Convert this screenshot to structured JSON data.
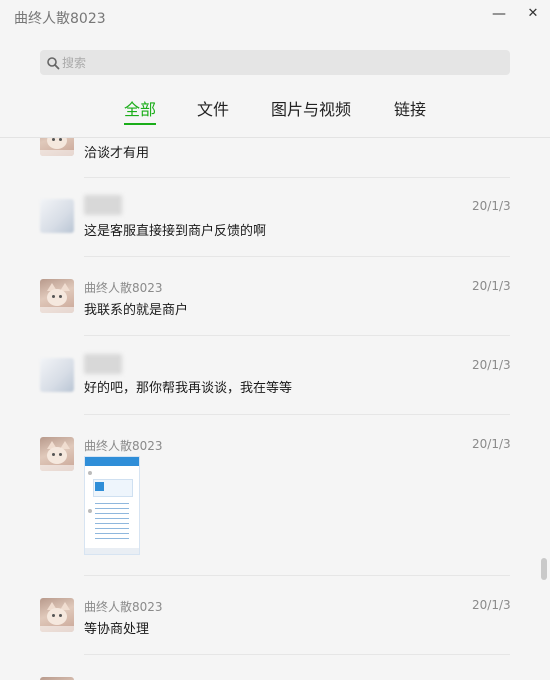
{
  "window": {
    "title": "曲终人散8023",
    "minimize_glyph": "—",
    "close_glyph": "✕"
  },
  "search": {
    "placeholder": "搜索",
    "value": ""
  },
  "tabs": [
    {
      "label": "全部",
      "active": true
    },
    {
      "label": "文件",
      "active": false
    },
    {
      "label": "图片与视频",
      "active": false
    },
    {
      "label": "链接",
      "active": false
    }
  ],
  "messages": [
    {
      "sender": "",
      "date": "",
      "text": "洽谈才有用",
      "avatar": "cat-avatar"
    },
    {
      "sender": "",
      "date": "20/1/3",
      "text": "这是客服直接接到商户反馈的啊",
      "avatar": "blurred-avatar"
    },
    {
      "sender": "曲终人散8023",
      "date": "20/1/3",
      "text": "我联系的就是商户",
      "avatar": "cat-avatar"
    },
    {
      "sender": "",
      "date": "20/1/3",
      "text": "好的吧，那你帮我再谈谈，我在等等",
      "avatar": "blurred-avatar"
    },
    {
      "sender": "曲终人散8023",
      "date": "20/1/3",
      "text": "",
      "avatar": "cat-avatar",
      "attachment": "image-thumbnail"
    },
    {
      "sender": "曲终人散8023",
      "date": "20/1/3",
      "text": "等协商处理",
      "avatar": "cat-avatar"
    },
    {
      "sender": "",
      "date": "",
      "text": "",
      "avatar": "cat-avatar"
    }
  ],
  "colors": {
    "accent": "#1aad19",
    "background": "#f5f5f5",
    "search_bg": "#e5e5e5"
  },
  "icons": {
    "search": "search-icon",
    "minimize": "minimize-icon",
    "close": "close-icon"
  }
}
